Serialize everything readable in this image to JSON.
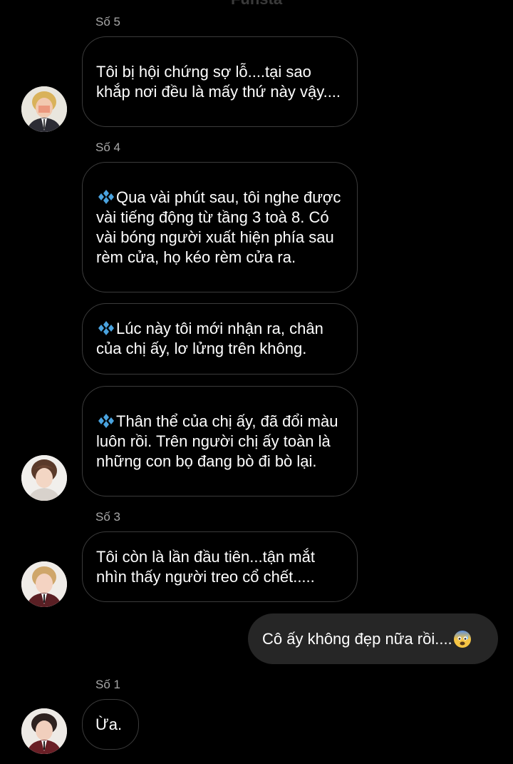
{
  "chat": {
    "header_title": "Funsta",
    "messages": [
      {
        "sender": "Số 5",
        "text": "Tôi bị hội chứng sợ lỗ....tại sao khắp nơi đều là mấy thứ này vậy...."
      },
      {
        "sender": "Số 4",
        "text": "Qua vài phút sau, tôi nghe được vài tiếng động từ tầng 3 toà 8. Có vài bóng người xuất hiện phía sau rèm cửa, họ kéo rèm cửa ra."
      },
      {
        "text": "Lúc này tôi mới nhận ra, chân của chị ấy, lơ lửng trên không."
      },
      {
        "text": "Thân thể của chị ấy, đã đổi màu luôn rồi. Trên người chị ấy toàn là những con bọ đang bò đi bò lại."
      },
      {
        "sender": "Số 3",
        "text": "Tôi còn là lần đầu tiên...tận mắt nhìn thấy người treo cổ chết....."
      },
      {
        "mine": true,
        "text": "Cô ấy không đẹp nữa rồi...."
      },
      {
        "sender": "Số 1",
        "text": "Ừa."
      }
    ]
  },
  "icons": {
    "diamond": "blue-diamond-icon",
    "emoji": "fearful-face-icon"
  },
  "colors": {
    "background": "#000000",
    "bubble_border": "#3b3b3b",
    "own_bubble": "#262626",
    "sender_label": "#a8a8a8",
    "diamond": "#4aa3df"
  }
}
